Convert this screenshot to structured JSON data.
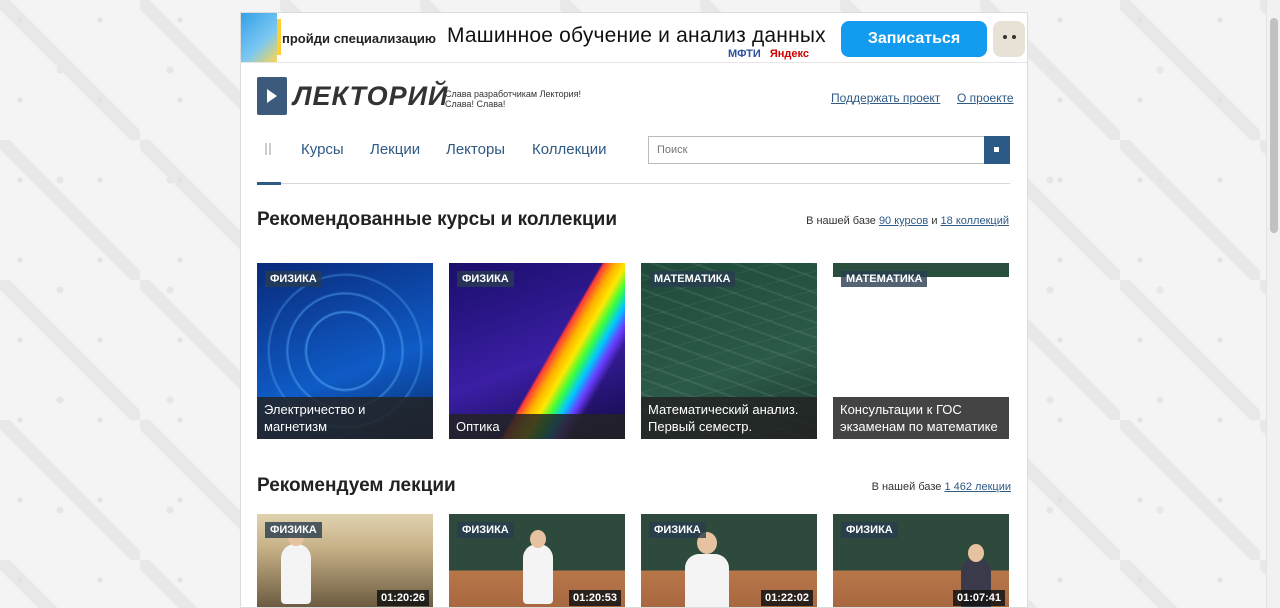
{
  "banner": {
    "small_text": "пройди специализацию",
    "title": "Машинное обучение и анализ данных",
    "logo_mfti": "МФТИ",
    "logo_yandex": "Яндекс",
    "button_label": "Записаться"
  },
  "header": {
    "logo_text": "ЛЕКТОРИЙ",
    "tagline_line1": "Слава разработчикам Лектория!",
    "tagline_line2": "Слава! Слава!",
    "support_link": "Поддержать проект",
    "about_link": "О проекте"
  },
  "nav": {
    "items": [
      "Курсы",
      "Лекции",
      "Лекторы",
      "Коллекции"
    ],
    "search_placeholder": "Поиск"
  },
  "courses_section": {
    "title": "Рекомендованные курсы и коллекции",
    "meta_prefix": "В нашей базе",
    "courses_link": "90 курсов",
    "meta_and": "и",
    "collections_link": "18 коллекций",
    "cards": [
      {
        "tag": "ФИЗИКА",
        "caption": "Электричество и магнетизм"
      },
      {
        "tag": "ФИЗИКА",
        "caption": "Оптика"
      },
      {
        "tag": "МАТЕМАТИКА",
        "caption": "Математический анализ. Первый семестр."
      },
      {
        "tag": "МАТЕМАТИКА",
        "caption": "Консультации к ГОС экзаменам по математике"
      }
    ]
  },
  "lectures_section": {
    "title": "Рекомендуем лекции",
    "meta_prefix": "В нашей базе",
    "lectures_link": "1 462 лекции",
    "cards": [
      {
        "tag": "ФИЗИКА",
        "duration": "01:20:26"
      },
      {
        "tag": "ФИЗИКА",
        "duration": "01:20:53"
      },
      {
        "tag": "ФИЗИКА",
        "duration": "01:22:02"
      },
      {
        "tag": "ФИЗИКА",
        "duration": "01:07:41"
      }
    ]
  }
}
